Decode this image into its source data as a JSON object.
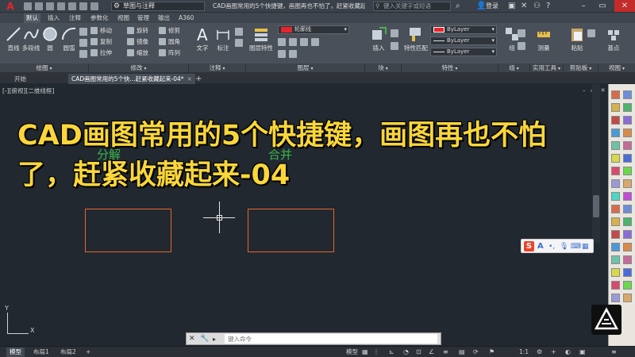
{
  "titlebar": {
    "app_logo": "A",
    "workspace": "草图与注释",
    "document_title": "CAD画图常用的5个快捷键，画图再也不怕了，赶紧收藏起来-04",
    "search_placeholder": "键入关键字或短语",
    "login_label": "登录",
    "icons": [
      "binoculars-icon",
      "user-icon",
      "cart-icon",
      "exchange-icon",
      "help-icon"
    ]
  },
  "ribbon_tabs": [
    "默认",
    "插入",
    "注释",
    "参数化",
    "视图",
    "管理",
    "输出",
    "A360"
  ],
  "ribbon": {
    "draw": {
      "tools": [
        "直线",
        "多段线",
        "圆",
        "圆弧"
      ],
      "panel": "绘图"
    },
    "modify": {
      "tools": [
        "移动",
        "旋转",
        "修剪",
        "复制",
        "镜像",
        "圆角",
        "拉伸",
        "缩放",
        "阵列"
      ],
      "panel": "修改"
    },
    "annotation": {
      "tools": [
        "文字",
        "标注"
      ],
      "panel": "注释"
    },
    "layers": {
      "tools": [
        "图层特性"
      ],
      "layer_name": "轮廓线",
      "panel": "图层"
    },
    "block": {
      "tools": [
        "插入"
      ],
      "panel": "块"
    },
    "properties": {
      "match": "特性匹配",
      "color": "ByLayer",
      "linetype": "ByLayer",
      "lineweight": "ByLayer",
      "panel": "特性"
    },
    "groups": {
      "tools": [
        "组"
      ],
      "panel": "组"
    },
    "utilities": {
      "tools": [
        "测量"
      ],
      "panel": "实用工具"
    },
    "clipboard": {
      "tools": [
        "粘贴"
      ],
      "panel": "剪贴板"
    },
    "view": {
      "tools": [
        "基点"
      ],
      "panel": "视图"
    }
  },
  "doc_tabs": {
    "start": "开始",
    "document": "CAD画图常用的5个快...赶紧收藏起来-04*",
    "close": "×",
    "add": "+"
  },
  "canvas": {
    "view_label": "[-][俯视][二维线框]",
    "overlay_title": "CAD画图常用的5个快捷键，画图再也不怕了，赶紧收藏起来-04",
    "ghost_labels": [
      "分解",
      "合并"
    ],
    "ucs_x": "X",
    "ucs_y": "Y",
    "colors": {
      "background": "#212830",
      "rectangle": "#e8662a",
      "title": "#f9d63a",
      "ghost_label": "#3ab54a"
    }
  },
  "ime": {
    "logo": "S",
    "mode": "A"
  },
  "command_line": {
    "placeholder": "键入命令"
  },
  "statusbar": {
    "tabs": [
      "模型",
      "布局1",
      "布局2"
    ],
    "add": "+",
    "model_label": "模型",
    "scale": "1:1"
  }
}
